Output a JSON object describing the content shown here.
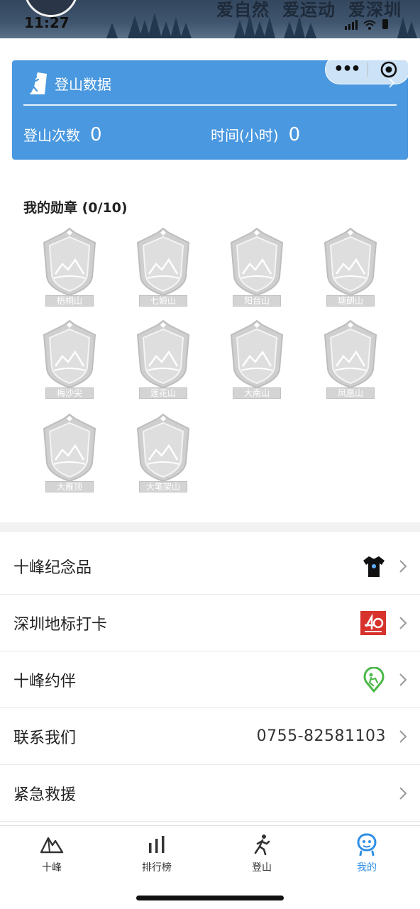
{
  "status_bar": {
    "time": "11:27"
  },
  "banner": {
    "slogans": [
      "爱自然",
      "爱运动",
      "爱深圳"
    ]
  },
  "data_card": {
    "title": "登山数据",
    "climb_count_label": "登山次数",
    "climb_count_value": "0",
    "hours_label": "时间(小时)",
    "hours_value": "0"
  },
  "medals": {
    "title": "我的勋章 (0/10)",
    "items": [
      {
        "name": "梧桐山",
        "icon": "mountain-badge-icon"
      },
      {
        "name": "七娘山",
        "icon": "mountain-badge-icon"
      },
      {
        "name": "阳台山",
        "icon": "mountain-badge-icon"
      },
      {
        "name": "塘朗山",
        "icon": "mountain-badge-icon"
      },
      {
        "name": "梅沙尖",
        "icon": "mountain-badge-icon"
      },
      {
        "name": "莲花山",
        "icon": "mountain-badge-icon"
      },
      {
        "name": "大南山",
        "icon": "mountain-badge-icon"
      },
      {
        "name": "凤凰山",
        "icon": "mountain-badge-icon"
      },
      {
        "name": "大雁顶",
        "icon": "mountain-badge-icon"
      },
      {
        "name": "大笔架山",
        "icon": "mountain-badge-icon"
      }
    ]
  },
  "menu": [
    {
      "label": "十峰纪念品",
      "icon": "tshirt-icon"
    },
    {
      "label": "深圳地标打卡",
      "icon": "shenzhen-40-logo-icon"
    },
    {
      "label": "十峰约伴",
      "icon": "partner-location-icon"
    },
    {
      "label": "联系我们",
      "value": "0755-82581103"
    },
    {
      "label": "紧急救援"
    }
  ],
  "tabbar": {
    "items": [
      {
        "label": "十峰",
        "icon": "mountain-icon"
      },
      {
        "label": "排行榜",
        "icon": "bar-chart-icon"
      },
      {
        "label": "登山",
        "icon": "hiker-icon"
      },
      {
        "label": "我的",
        "icon": "profile-icon"
      }
    ],
    "active": "我的",
    "active_color": "#2f8fe6"
  },
  "colors": {
    "card_blue": "#4a98df",
    "medal_grey": "#d4d4d4"
  }
}
